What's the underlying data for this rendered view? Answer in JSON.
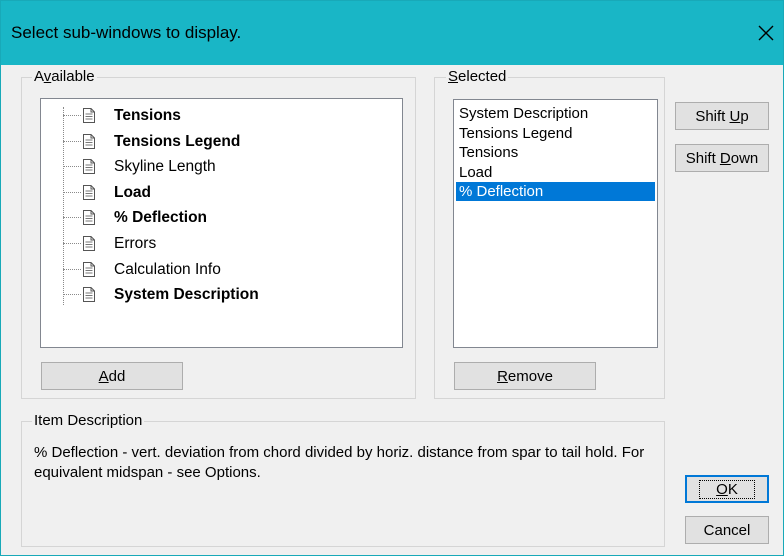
{
  "window": {
    "title": "Select sub-windows to display.",
    "accent_color": "#19b6c6"
  },
  "available": {
    "label_pre": "A",
    "label_u": "v",
    "label_post": "ailable",
    "items": [
      {
        "label": "Tensions",
        "bold": true
      },
      {
        "label": "Tensions Legend",
        "bold": true
      },
      {
        "label": "Skyline Length",
        "bold": false
      },
      {
        "label": "Load",
        "bold": true
      },
      {
        "label": "% Deflection",
        "bold": true
      },
      {
        "label": "Errors",
        "bold": false
      },
      {
        "label": "Calculation Info",
        "bold": false
      },
      {
        "label": "System Description",
        "bold": true
      }
    ],
    "add_u": "A",
    "add_post": "dd"
  },
  "selected": {
    "label_pre": "",
    "label_u": "S",
    "label_post": "elected",
    "items": [
      {
        "label": "System Description",
        "selected": false
      },
      {
        "label": "Tensions Legend",
        "selected": false
      },
      {
        "label": "Tensions",
        "selected": false
      },
      {
        "label": "Load",
        "selected": false
      },
      {
        "label": "% Deflection",
        "selected": true
      }
    ],
    "remove_u": "R",
    "remove_post": "emove"
  },
  "buttons": {
    "shift_up_pre": "Shift ",
    "shift_up_u": "U",
    "shift_up_post": "p",
    "shift_down_pre": "Shift ",
    "shift_down_u": "D",
    "shift_down_post": "own",
    "ok_pre": "",
    "ok_u": "O",
    "ok_post": "K",
    "cancel": "Cancel"
  },
  "description": {
    "label": "Item Description",
    "text": "% Deflection - vert. deviation from chord divided by horiz. distance from spar to tail hold. For equivalent midspan - see Options."
  }
}
